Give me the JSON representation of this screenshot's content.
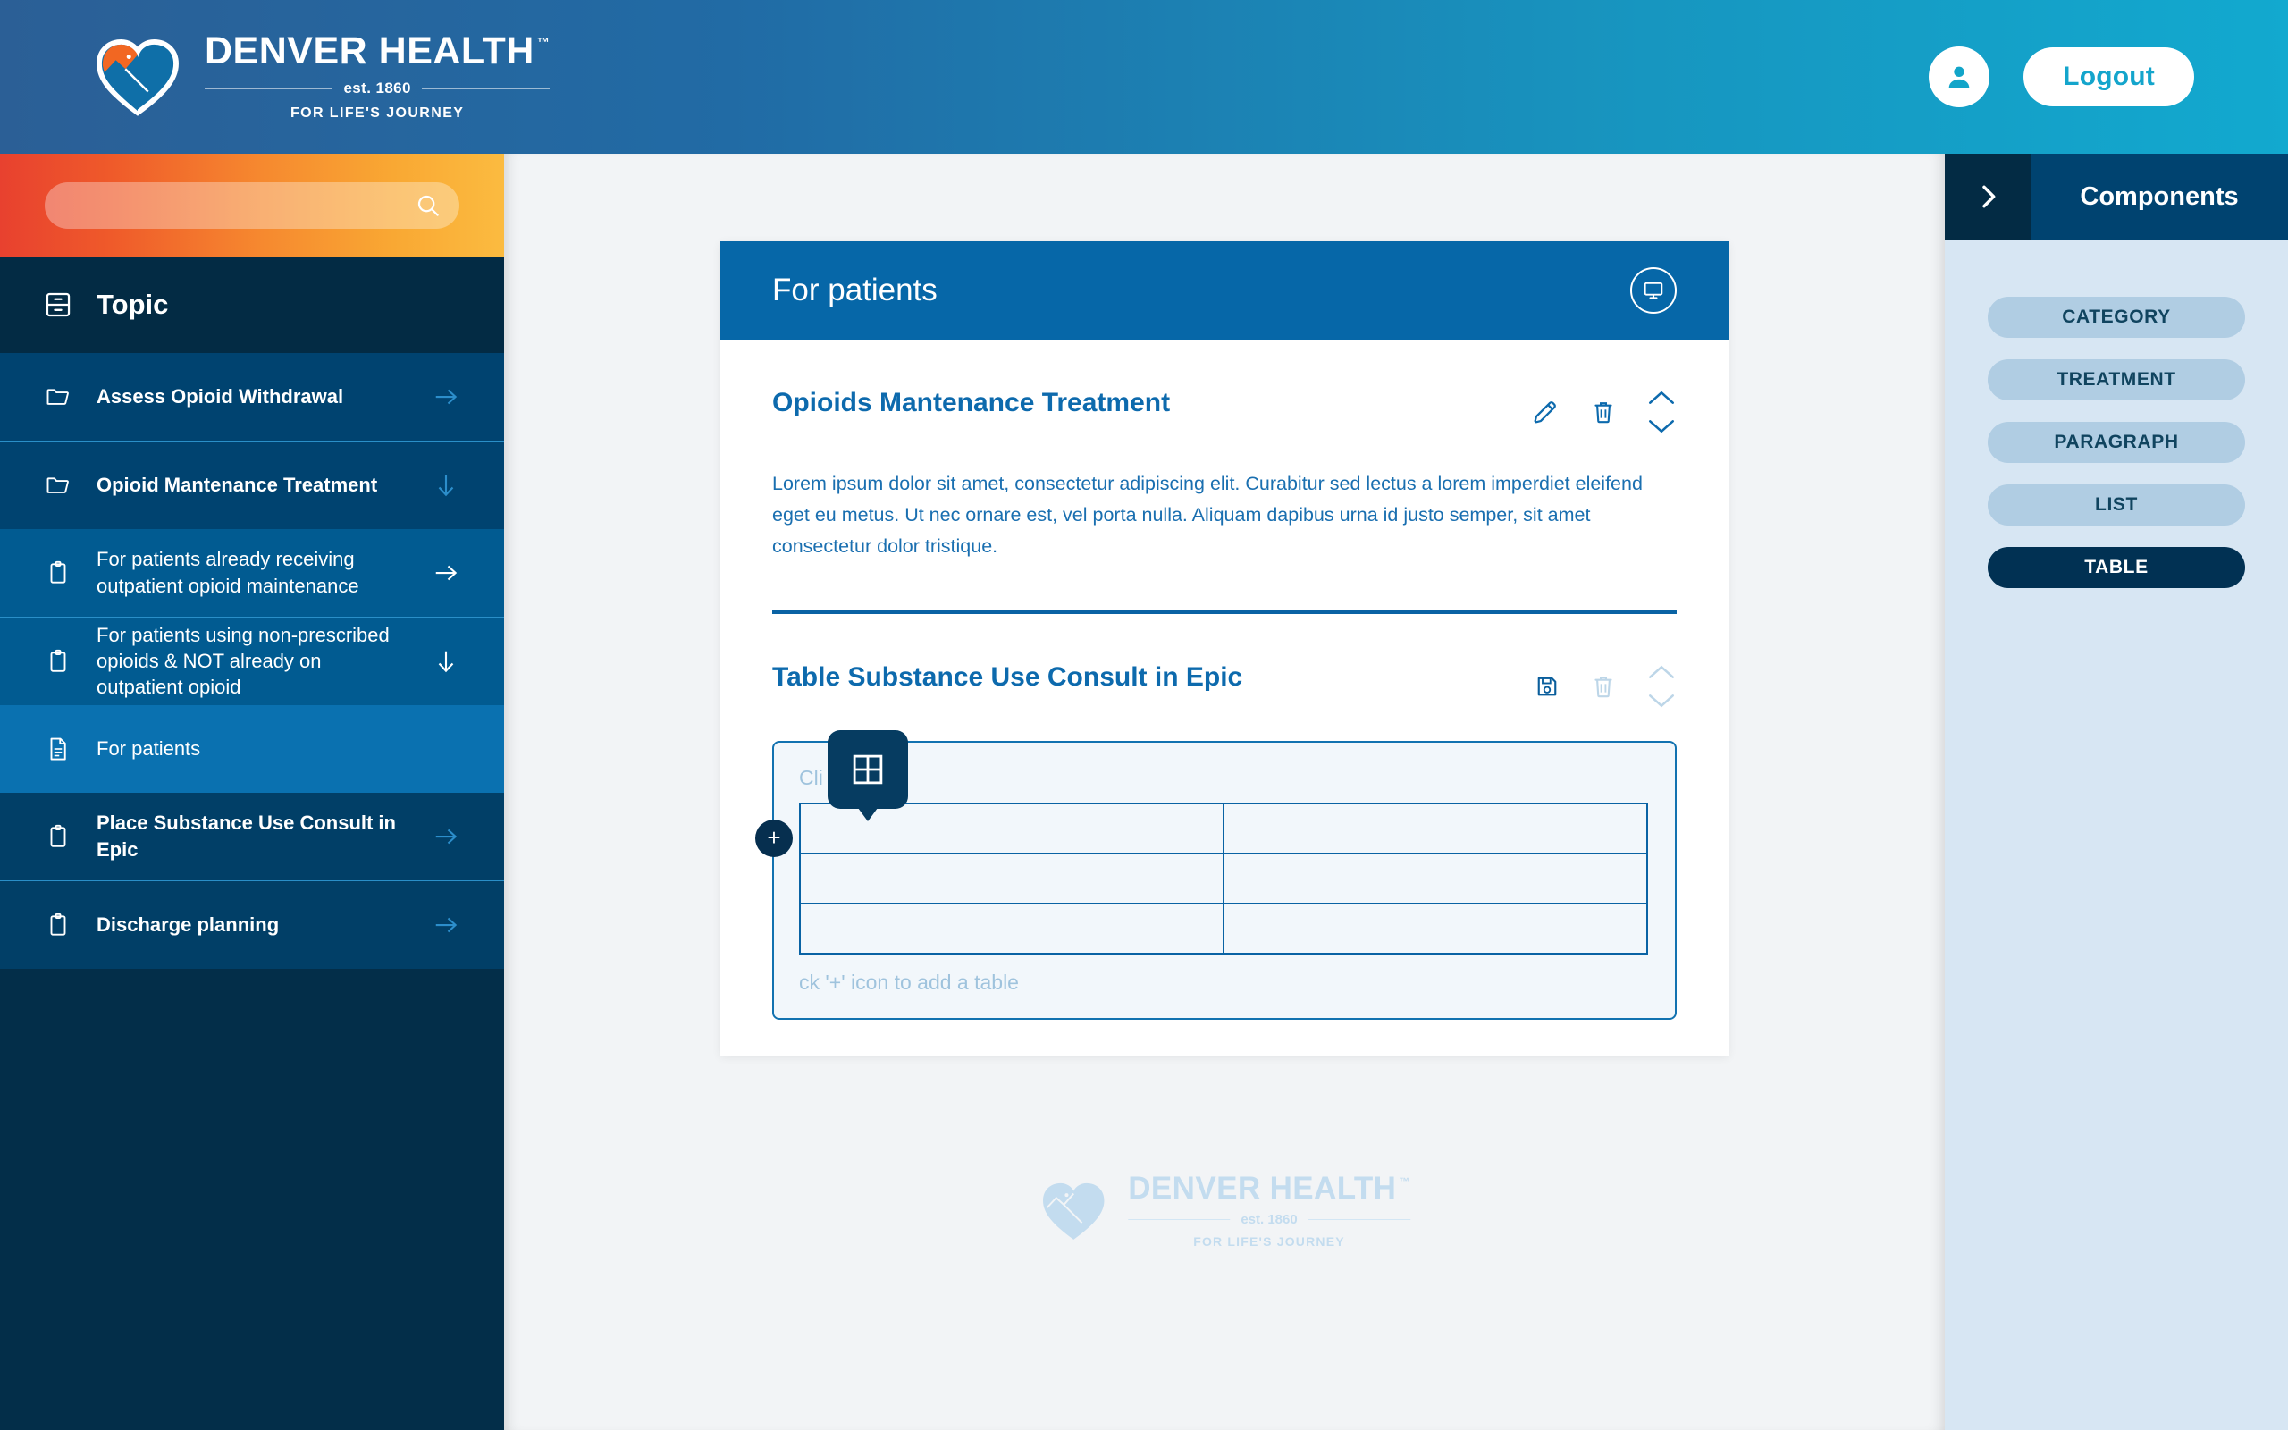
{
  "header": {
    "brand_name": "DENVER HEALTH",
    "brand_tm": "™",
    "brand_est": "est. 1860",
    "brand_tagline": "FOR LIFE'S JOURNEY",
    "avatar_icon": "user-icon",
    "logout_label": "Logout",
    "gradient_from": "#2b5f96",
    "gradient_to": "#12a9cf"
  },
  "sidebar": {
    "search": {
      "value": "",
      "placeholder": "",
      "icon": "search-icon"
    },
    "topic_header": {
      "label": "Topic",
      "icon": "archive-cabinet-icon"
    },
    "items": [
      {
        "label": "Assess Opioid Withdrawal",
        "icon": "folder-icon",
        "arrow": "arrow-right-icon",
        "level": "lvl0",
        "active": false
      },
      {
        "label": "Opioid Mantenance Treatment",
        "icon": "folder-icon",
        "arrow": "arrow-down-icon",
        "level": "lvl0",
        "active": false
      },
      {
        "label": "For patients already receiving outpatient opioid maintenance",
        "icon": "clipboard-icon",
        "arrow": "arrow-right-icon",
        "level": "lvl1",
        "active": false
      },
      {
        "label": "For patients using non-prescribed opioids & NOT already on outpatient opioid",
        "icon": "clipboard-icon",
        "arrow": "arrow-down-icon",
        "level": "lvl1",
        "active": false
      },
      {
        "label": "For patients",
        "icon": "document-icon",
        "arrow": "",
        "level": "lvl1",
        "active": true
      },
      {
        "label": "Place Substance Use Consult in Epic",
        "icon": "clipboard-icon",
        "arrow": "arrow-right-icon",
        "level": "lvl2",
        "active": false
      },
      {
        "label": "Discharge planning",
        "icon": "clipboard-icon",
        "arrow": "arrow-right-icon",
        "level": "lvl2",
        "active": false
      }
    ]
  },
  "main": {
    "card_title": "For patients",
    "card_header_icon": "monitor-icon",
    "blocks": [
      {
        "title": "Opioids Mantenance Treatment",
        "body": "Lorem ipsum dolor sit amet, consectetur adipiscing elit. Curabitur sed lectus a lorem imperdiet eleifend eget eu metus. Ut nec ornare est, vel porta nulla. Aliquam dapibus urna id justo semper, sit amet consectetur dolor tristique.",
        "tools": [
          "pencil-edit-icon",
          "trash-delete-icon",
          "move-up-down-icon"
        ]
      },
      {
        "title": "Table Substance Use Consult in Epic",
        "tools": [
          "save-disk-icon",
          "trash-delete-icon",
          "move-up-down-icon"
        ],
        "dropzone": {
          "hint_top": "Cli",
          "hint_bottom": "ck '+' icon to add a table",
          "add_badge": "+",
          "tooltip_icon": "table-grid-icon",
          "rows": 3,
          "cols": 2
        }
      }
    ]
  },
  "watermark": {
    "name": "DENVER HEALTH",
    "tm": "™",
    "est": "est. 1860",
    "tagline": "FOR LIFE'S JOURNEY"
  },
  "right_panel": {
    "toggle_icon": "chevron-right-icon",
    "title": "Components",
    "chips": [
      {
        "label": "CATEGORY",
        "selected": false
      },
      {
        "label": "TREATMENT",
        "selected": false
      },
      {
        "label": "PARAGRAPH",
        "selected": false
      },
      {
        "label": "LIST",
        "selected": false
      },
      {
        "label": "TABLE",
        "selected": true
      }
    ]
  },
  "colors": {
    "brand_blue": "#0667a8",
    "dark_navy": "#032e49",
    "accent_cyan": "#12a9cf",
    "panel_bg": "#d7e6f3"
  }
}
